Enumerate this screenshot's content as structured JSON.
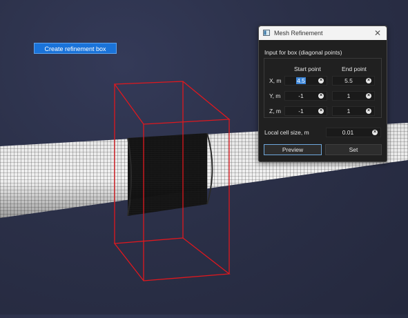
{
  "toolbar": {
    "create_box_label": "Create refinement box"
  },
  "dialog": {
    "title": "Mesh Refinement",
    "box_label": "Input for box (diagonal points)",
    "start_header": "Start point",
    "end_header": "End point",
    "rows": [
      {
        "label": "X, m",
        "start": "4.5",
        "end": "5.5"
      },
      {
        "label": "Y, m",
        "start": "-1",
        "end": "1"
      },
      {
        "label": "Z, m",
        "start": "-1",
        "end": "1"
      }
    ],
    "local_cell_label": "Local cell size, m",
    "local_cell_value": "0.01",
    "preview_label": "Preview",
    "set_label": "Set"
  },
  "colors": {
    "accent": "#1a73d9",
    "box_outline": "#e0181e",
    "background": "#2b3048"
  }
}
